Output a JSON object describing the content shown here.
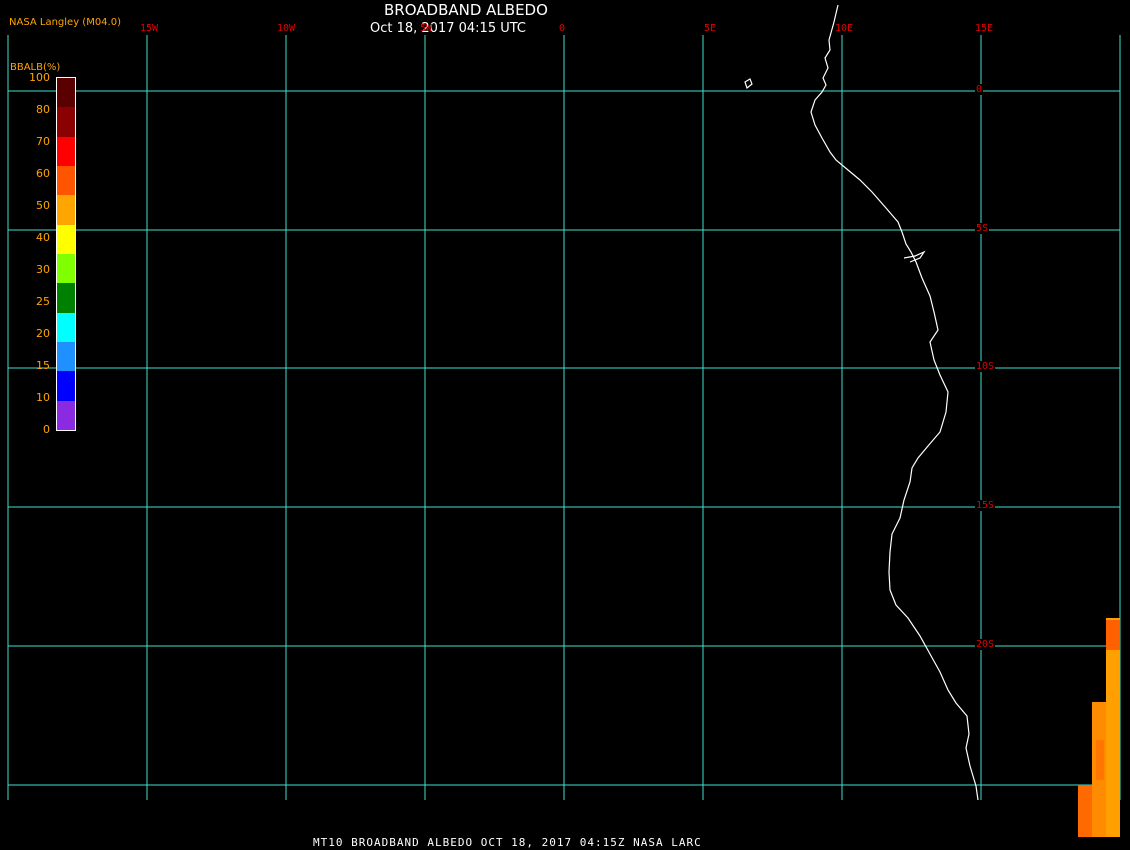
{
  "header": {
    "title": "BROADBAND ALBEDO",
    "subtitle": "Oct 18, 2017 04:15 UTC",
    "credit": "NASA Langley (M04.0)"
  },
  "footer": {
    "text": "MT10  BROADBAND ALBEDO   OCT 18, 2017 04:15Z   NASA LARC"
  },
  "legend": {
    "title": "BBALB(%)",
    "labels": [
      "100",
      "80",
      "70",
      "60",
      "50",
      "40",
      "30",
      "25",
      "20",
      "15",
      "10",
      "0"
    ],
    "colors": [
      "#5a0000",
      "#8b0000",
      "#ff0000",
      "#ff5500",
      "#ffa500",
      "#ffff00",
      "#80ff00",
      "#008000",
      "#00ffff",
      "#1e90ff",
      "#0000ff",
      "#8a2be2"
    ]
  },
  "grid": {
    "longitude_labels": [
      "15W",
      "10W",
      "5W",
      "0",
      "5E",
      "10E",
      "15E"
    ],
    "latitude_labels": [
      "0",
      "5S",
      "10S",
      "15S",
      "20S"
    ],
    "line_color": "#40e0d0",
    "label_color": "#e00000"
  }
}
